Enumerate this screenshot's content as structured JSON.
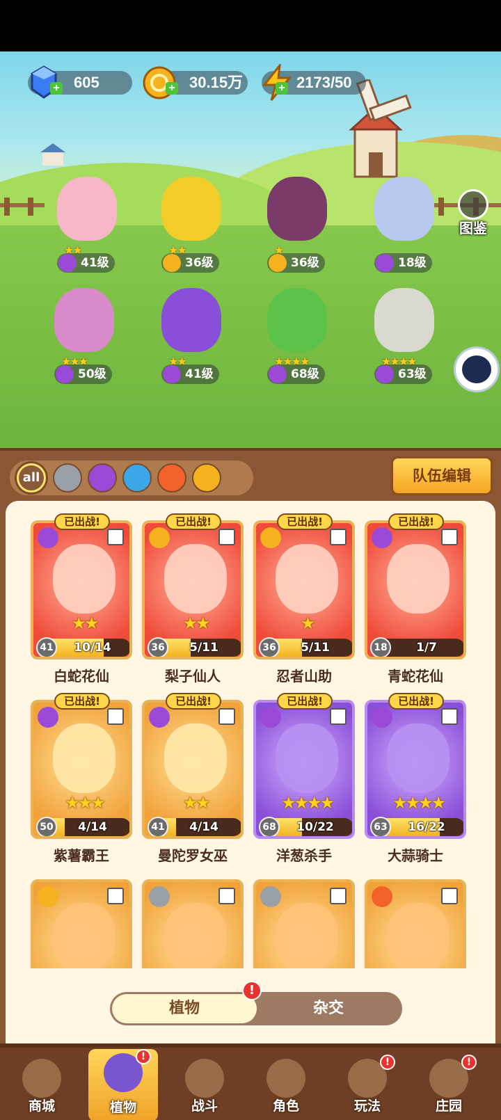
{
  "currencies": {
    "gems": "605",
    "gold": "30.15万",
    "energy": "2173/50"
  },
  "side": {
    "encyclopedia_label": "图鉴"
  },
  "scene_plants": [
    {
      "level": "41级",
      "stars": "★★",
      "element": "purple"
    },
    {
      "level": "36级",
      "stars": "★★",
      "element": "lightning"
    },
    {
      "level": "36级",
      "stars": "★",
      "element": "lightning"
    },
    {
      "level": "18级",
      "stars": "",
      "element": "purple"
    },
    {
      "level": "50级",
      "stars": "★★★",
      "element": "purple"
    },
    {
      "level": "41级",
      "stars": "★★",
      "element": "purple"
    },
    {
      "level": "68级",
      "stars": "★★★★",
      "element": "purple"
    },
    {
      "level": "63级",
      "stars": "★★★★",
      "element": "purple"
    }
  ],
  "filters": {
    "all_label": "all",
    "team_edit_label": "队伍编辑"
  },
  "cards": [
    {
      "name": "白蛇花仙",
      "deployed": "已出战!",
      "stars": "★★",
      "level": "41",
      "progress": "10/14",
      "progress_ratio": 0.71,
      "rarity": "red",
      "element": "purple"
    },
    {
      "name": "梨子仙人",
      "deployed": "已出战!",
      "stars": "★★",
      "level": "36",
      "progress": "5/11",
      "progress_ratio": 0.45,
      "rarity": "red",
      "element": "lightning"
    },
    {
      "name": "忍者山助",
      "deployed": "已出战!",
      "stars": "★",
      "level": "36",
      "progress": "5/11",
      "progress_ratio": 0.45,
      "rarity": "red",
      "element": "lightning"
    },
    {
      "name": "青蛇花仙",
      "deployed": "已出战!",
      "stars": "",
      "level": "18",
      "progress": "1/7",
      "progress_ratio": 0.14,
      "rarity": "red",
      "element": "purple"
    },
    {
      "name": "紫薯霸王",
      "deployed": "已出战!",
      "stars": "★★★",
      "level": "50",
      "progress": "4/14",
      "progress_ratio": 0.29,
      "rarity": "orange",
      "element": "purple"
    },
    {
      "name": "曼陀罗女巫",
      "deployed": "已出战!",
      "stars": "★★",
      "level": "41",
      "progress": "4/14",
      "progress_ratio": 0.29,
      "rarity": "orange",
      "element": "purple"
    },
    {
      "name": "洋葱杀手",
      "deployed": "已出战!",
      "stars": "★★★★",
      "level": "68",
      "progress": "10/22",
      "progress_ratio": 0.45,
      "rarity": "purple",
      "element": "purple"
    },
    {
      "name": "大蒜骑士",
      "deployed": "已出战!",
      "stars": "★★★★",
      "level": "63",
      "progress": "16/22",
      "progress_ratio": 0.73,
      "rarity": "purple",
      "element": "purple"
    }
  ],
  "partial_cards": [
    {
      "rarity": "orange",
      "element": "lightning"
    },
    {
      "rarity": "orange",
      "element": "sword"
    },
    {
      "rarity": "orange",
      "element": "sword"
    },
    {
      "rarity": "orange",
      "element": "fire"
    }
  ],
  "toggle": {
    "left": "植物",
    "right": "杂交",
    "badge": "!"
  },
  "nav": {
    "items": [
      {
        "label": "商城",
        "active": false,
        "badge": ""
      },
      {
        "label": "植物",
        "active": true,
        "badge": "!"
      },
      {
        "label": "战斗",
        "active": false,
        "badge": ""
      },
      {
        "label": "角色",
        "active": false,
        "badge": ""
      },
      {
        "label": "玩法",
        "active": false,
        "badge": "!"
      },
      {
        "label": "庄园",
        "active": false,
        "badge": "!"
      }
    ]
  },
  "colors": {
    "purple_element": "#9b4ad8",
    "lightning_element": "#f5b21e",
    "sword_element": "#9aa0a8",
    "water_element": "#3aa8e8",
    "fire_element": "#f2622a"
  }
}
